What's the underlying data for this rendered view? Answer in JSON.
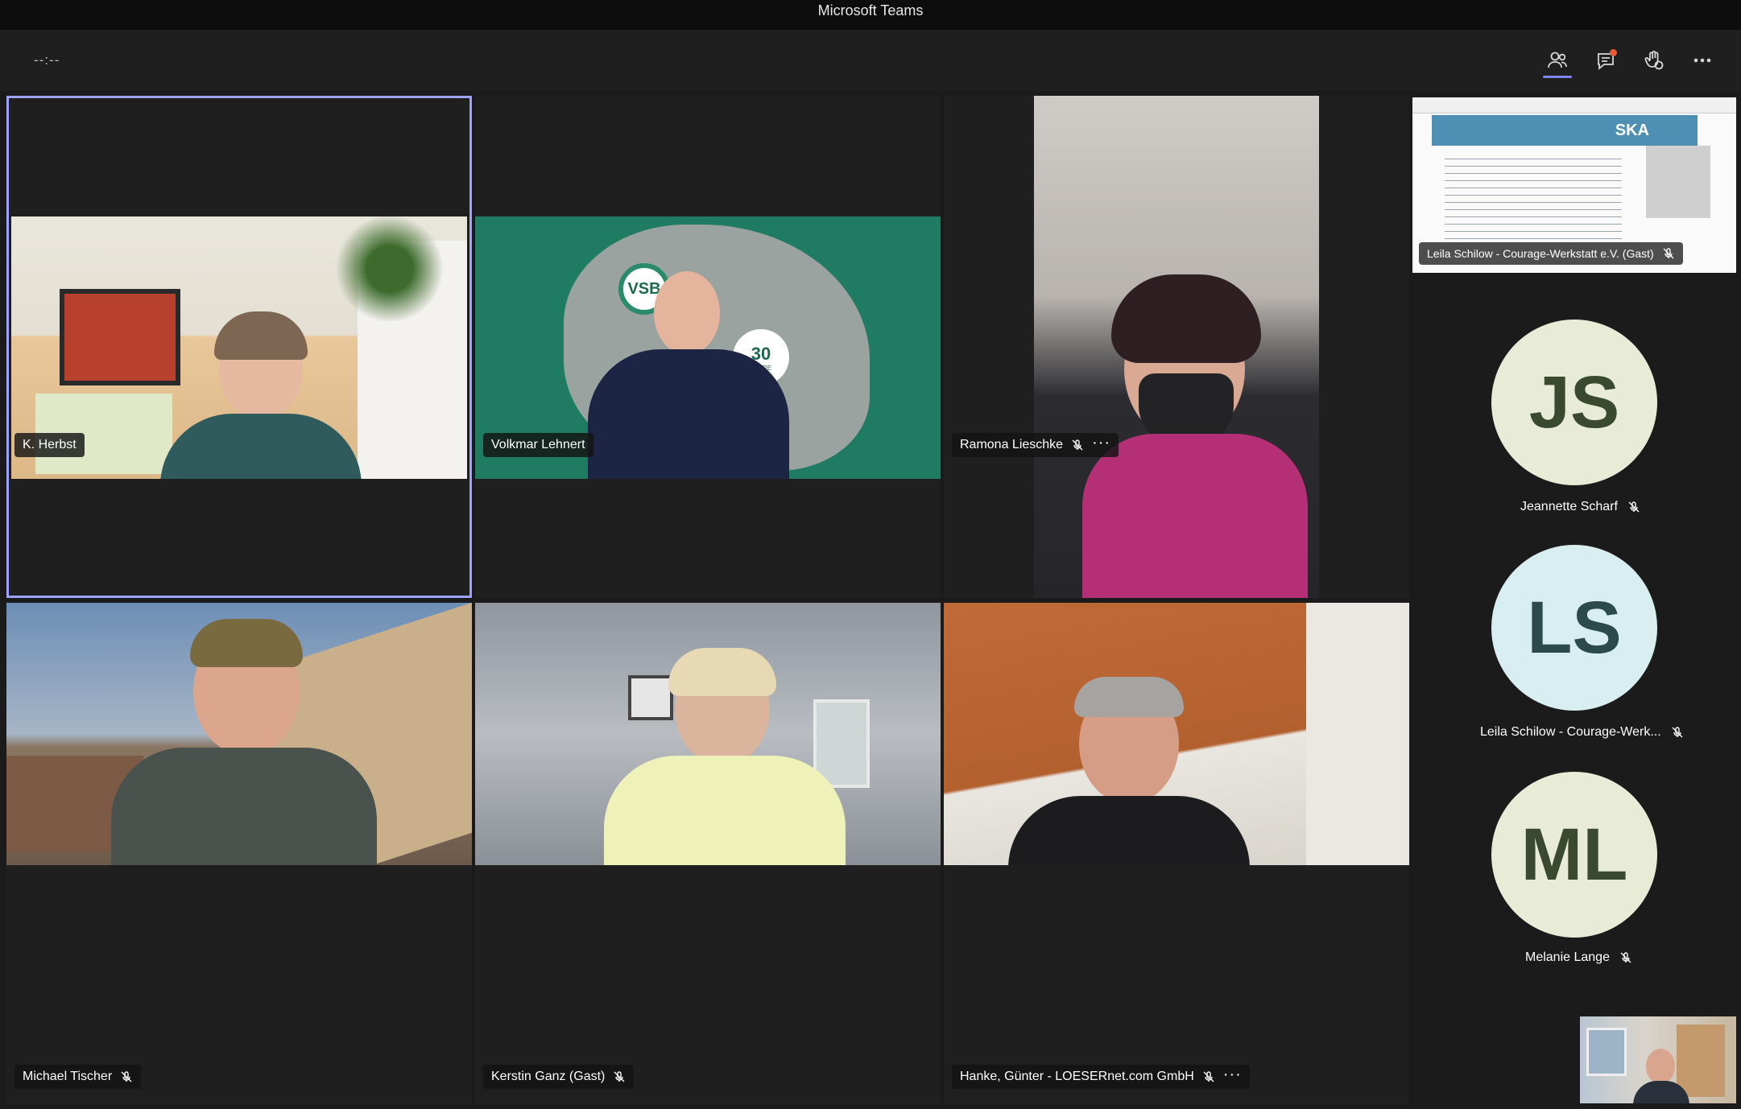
{
  "window": {
    "title": "Microsoft Teams"
  },
  "toolbar": {
    "timer": "--:--",
    "participants_icon": "people-icon",
    "chat_icon": "chat-icon",
    "reactions_icon": "hand-emoji-icon",
    "more_icon": "more-icon",
    "chat_has_notification": true
  },
  "participants": [
    {
      "name": "K. Herbst",
      "muted": false,
      "speaking": true,
      "more": false
    },
    {
      "name": "Volkmar Lehnert",
      "muted": false,
      "speaking": false,
      "more": false
    },
    {
      "name": "Ramona Lieschke",
      "muted": true,
      "speaking": false,
      "more": true
    },
    {
      "name": "Michael Tischer",
      "muted": true,
      "speaking": false,
      "more": false
    },
    {
      "name": "Kerstin Ganz (Gast)",
      "muted": true,
      "speaking": false,
      "more": false
    },
    {
      "name": "Hanke, Günter - LOESERnet.com GmbH",
      "muted": true,
      "speaking": false,
      "more": true
    }
  ],
  "screen_share": {
    "presenter_label": "Leila Schilow - Courage-Werkstatt e.V. (Gast)",
    "slide_logo": "SKA"
  },
  "virtual_background": {
    "logo": "VSB",
    "badge_number": "30",
    "badge_text": "JAHRE"
  },
  "sidebar_avatars": [
    {
      "initials": "JS",
      "name": "Jeannette Scharf",
      "bg": "#e8ecd6",
      "fg": "#3a4a2e"
    },
    {
      "initials": "LS",
      "name": "Leila Schilow - Courage-Werk...",
      "bg": "#d9eef0",
      "fg": "#2c4a4a"
    },
    {
      "initials": "ML",
      "name": "Melanie Lange",
      "bg": "#e8ecd6",
      "fg": "#3a4a2e"
    }
  ],
  "colors": {
    "accent": "#9ea2ff",
    "titlebar": "#0d0d0d",
    "stage": "#1b1b1b",
    "notification": "#e8593a"
  }
}
